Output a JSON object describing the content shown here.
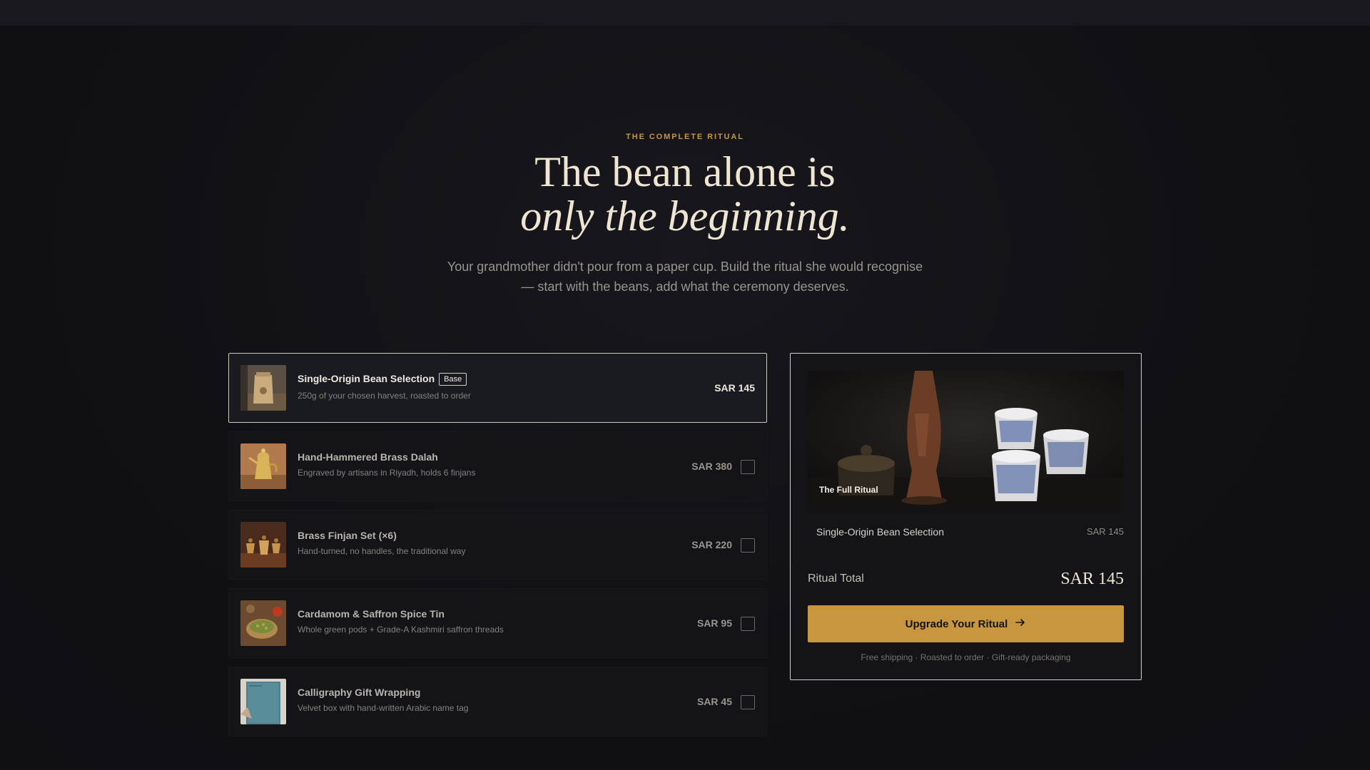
{
  "hero": {
    "eyebrow": "THE COMPLETE RITUAL",
    "headline_line1": "The bean alone is",
    "headline_line2": "only the beginning.",
    "subtitle": "Your grandmother didn't pour from a paper cup. Build the ritual she would recognise — start with the beans, add what the ceremony deserves."
  },
  "items": [
    {
      "name": "Single-Origin Bean Selection",
      "badge": "Base",
      "description": "250g of your chosen harvest, roasted to order",
      "price": "SAR 145",
      "selected": true,
      "checked": true
    },
    {
      "name": "Hand-Hammered Brass Dalah",
      "description": "Engraved by artisans in Riyadh, holds 6 finjans",
      "price": "SAR 380",
      "checked": false
    },
    {
      "name": "Brass Finjan Set (×6)",
      "description": "Hand-turned, no handles, the traditional way",
      "price": "SAR 220",
      "checked": false
    },
    {
      "name": "Cardamom & Saffron Spice Tin",
      "description": "Whole green pods + Grade-A Kashmiri saffron threads",
      "price": "SAR 95",
      "checked": false
    },
    {
      "name": "Calligraphy Gift Wrapping",
      "description": "Velvet box with hand-written Arabic name tag",
      "price": "SAR 45",
      "checked": false
    }
  ],
  "summary": {
    "image_caption": "The Full Ritual",
    "lines": [
      {
        "name": "Single-Origin Bean Selection",
        "price": "SAR 145"
      }
    ],
    "total_label": "Ritual Total",
    "total_value": "SAR 145",
    "cta_label": "Upgrade Your Ritual",
    "fine_print": "Free shipping · Roasted to order · Gift-ready packaging"
  },
  "colors": {
    "accent": "#c8963e",
    "background": "#0f0f14",
    "card": "#131318",
    "headline": "#efe5d3"
  },
  "icons": {
    "cta": "arrow-right-icon"
  }
}
